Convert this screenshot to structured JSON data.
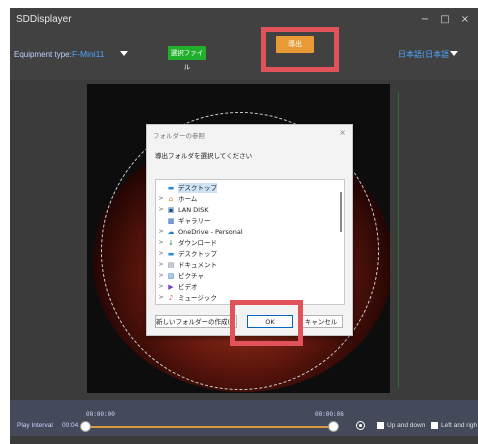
{
  "window": {
    "title": "SDDisplayer",
    "minimize": "−",
    "maximize": "□",
    "close": "×"
  },
  "toolbar": {
    "equipment_label": "Equipment type:",
    "equipment_value": "F-Mini11",
    "select_file_label": "選択ファイル",
    "export_label": "導出",
    "language_value": "日本語(日本語"
  },
  "dialog": {
    "title": "フォルダーの参照",
    "close": "×",
    "instruction": "導出フォルダを選択してください",
    "tree": [
      {
        "label": "デスクトップ",
        "icon": "desktop-folder-icon",
        "chevron": "",
        "selected": true
      },
      {
        "label": "ホーム",
        "icon": "home-icon",
        "chevron": ">"
      },
      {
        "label": "LAN DISK",
        "icon": "network-drive-icon",
        "chevron": ">"
      },
      {
        "label": "ギャラリー",
        "icon": "gallery-icon",
        "chevron": ""
      },
      {
        "label": "OneDrive - Personal",
        "icon": "cloud-icon",
        "chevron": ">"
      },
      {
        "label": "ダウンロード",
        "icon": "download-icon",
        "chevron": ">"
      },
      {
        "label": "デスクトップ",
        "icon": "desktop-folder-icon",
        "chevron": ">"
      },
      {
        "label": "ドキュメント",
        "icon": "document-icon",
        "chevron": ">"
      },
      {
        "label": "ピクチャ",
        "icon": "pictures-icon",
        "chevron": ">"
      },
      {
        "label": "ビデオ",
        "icon": "video-icon",
        "chevron": ">"
      },
      {
        "label": "ミュージック",
        "icon": "music-icon",
        "chevron": ">"
      }
    ],
    "new_folder_label": "新しいフォルダーの作成(M)",
    "ok_label": "OK",
    "cancel_label": "キャンセル"
  },
  "playback": {
    "interval_label": "Play Interval",
    "interval_value": "00:04",
    "start_time": "00:00:00",
    "end_time": "00:00:06",
    "up_down_label": "Up and down",
    "left_right_label": "Left and righ"
  },
  "colors": {
    "accent": "#4da6ff",
    "export": "#e99a34",
    "select_file": "#22b02c",
    "highlight": "#e2525b"
  }
}
